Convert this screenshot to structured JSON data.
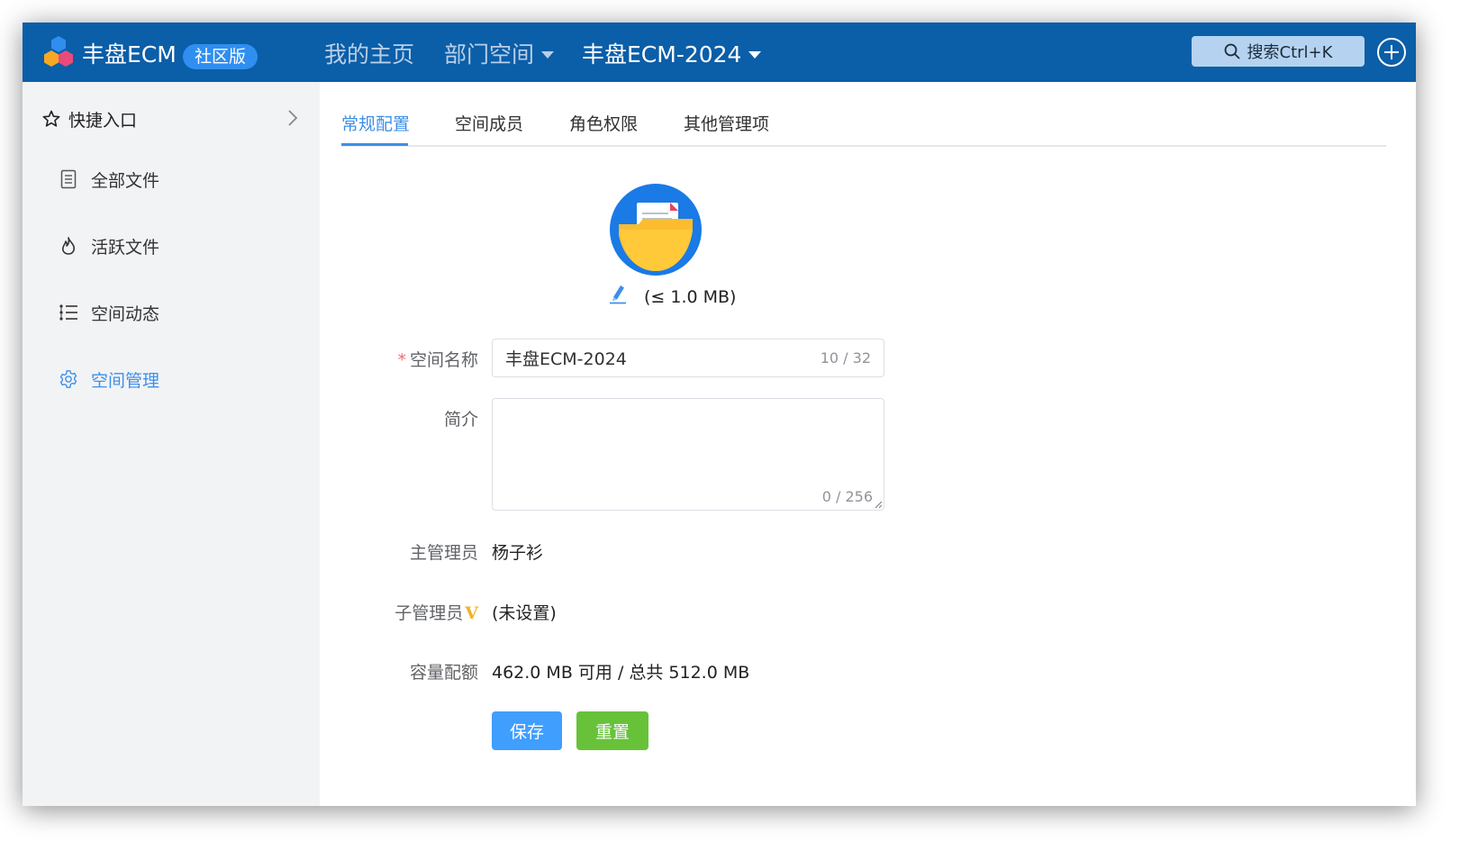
{
  "header": {
    "app_name": "丰盘ECM",
    "edition_badge": "社区版",
    "nav": [
      {
        "label": "我的主页"
      },
      {
        "label": "部门空间"
      },
      {
        "label": "丰盘ECM-2024"
      }
    ],
    "search_label": "搜索Ctrl+K"
  },
  "sidebar": {
    "quick_entry": "快捷入口",
    "items": [
      {
        "label": "全部文件",
        "icon": "document-icon"
      },
      {
        "label": "活跃文件",
        "icon": "flame-icon"
      },
      {
        "label": "空间动态",
        "icon": "timeline-list-icon"
      },
      {
        "label": "空间管理",
        "icon": "gear-icon",
        "active": true
      }
    ]
  },
  "tabs": [
    {
      "label": "常规配置",
      "active": true
    },
    {
      "label": "空间成员"
    },
    {
      "label": "角色权限"
    },
    {
      "label": "其他管理项"
    }
  ],
  "form": {
    "avatar_size_limit": "(≤ 1.0 MB)",
    "name": {
      "required_mark": "*",
      "label": "空间名称",
      "value": "丰盘ECM-2024",
      "count": "10 / 32"
    },
    "intro": {
      "label": "简介",
      "value": "",
      "count": "0 / 256"
    },
    "owner": {
      "label": "主管理员",
      "value": "杨子衫"
    },
    "sub_admin": {
      "label": "子管理员",
      "vip_mark": "V",
      "value": "(未设置)"
    },
    "quota": {
      "label": "容量配额",
      "value": "462.0 MB 可用 / 总共 512.0 MB"
    },
    "save_label": "保存",
    "reset_label": "重置"
  },
  "colors": {
    "header_bg": "#0b5ea8",
    "accent": "#3e8fe9",
    "save_button": "#409eff",
    "reset_button": "#67c23a",
    "vip": "#f0b429"
  }
}
